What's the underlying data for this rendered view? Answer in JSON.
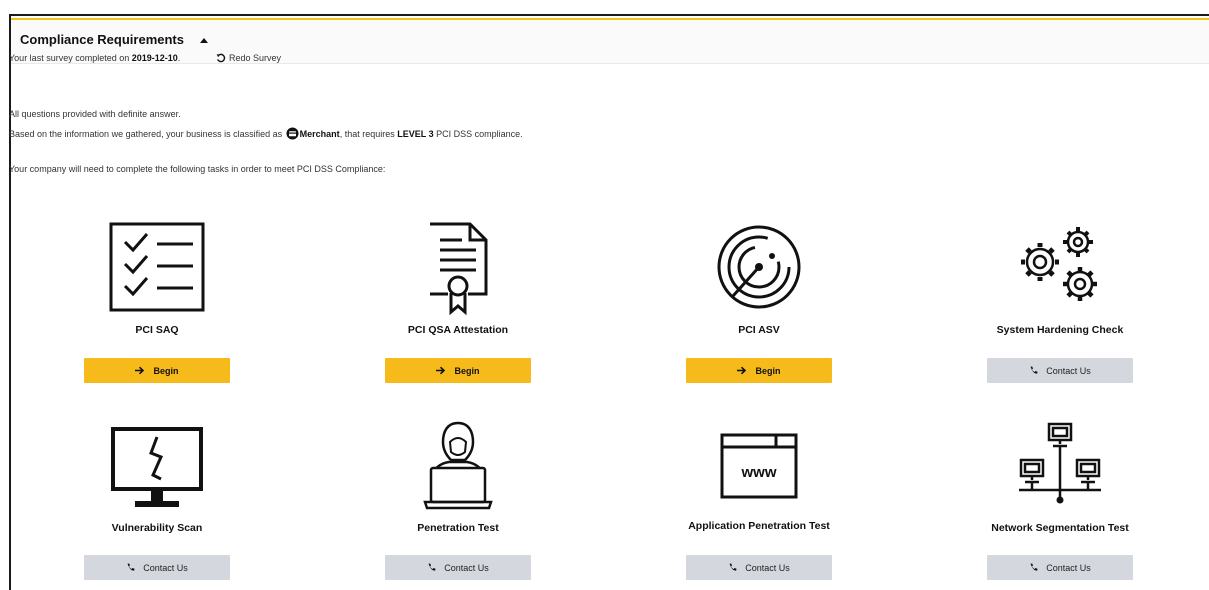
{
  "panel": {
    "title": "Compliance Requirements",
    "accent_color": "#f5c21b"
  },
  "survey": {
    "prefix": "Your last survey completed on",
    "date": "2019-12-10",
    "suffix": ".",
    "redo_label": "Redo Survey"
  },
  "status": {
    "answers_text": "All questions provided with definite answer.",
    "classification_prefix": "Based on the information we gathered, your business is classified as",
    "classification": "Merchant",
    "classification_middle": ", that requires",
    "level": "LEVEL 3",
    "classification_suffix": "PCI DSS compliance.",
    "tasks_intro": "Your company will need to complete the following tasks in order to meet PCI DSS Compliance:"
  },
  "buttons": {
    "begin_label": "Begin",
    "contact_label": "Contact Us",
    "begin_color": "#f6bb1b",
    "contact_color": "#d4d7dd"
  },
  "tasks": [
    {
      "title": "PCI SAQ",
      "icon": "checklist-icon",
      "action": "begin"
    },
    {
      "title": "PCI QSA Attestation",
      "icon": "certificate-icon",
      "action": "begin"
    },
    {
      "title": "PCI ASV",
      "icon": "radar-icon",
      "action": "begin"
    },
    {
      "title": "System Hardening Check",
      "icon": "gears-icon",
      "action": "contact"
    },
    {
      "title": "Vulnerability Scan",
      "icon": "broken-monitor-icon",
      "action": "contact"
    },
    {
      "title": "Penetration Test",
      "icon": "hacker-laptop-icon",
      "action": "contact"
    },
    {
      "title": "Application Penetration Test",
      "icon": "browser-window-icon",
      "action": "contact"
    },
    {
      "title": "Network Segmentation Test",
      "icon": "network-computers-icon",
      "action": "contact"
    }
  ],
  "icon_text": {
    "www": "www"
  }
}
